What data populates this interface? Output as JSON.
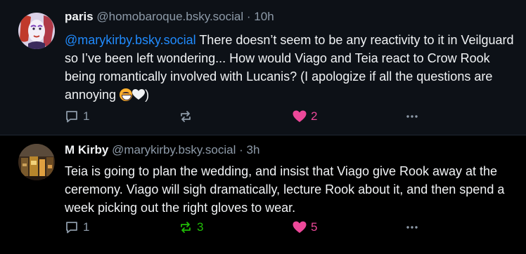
{
  "posts": [
    {
      "author": "paris",
      "handle": "@homobaroque.bsky.social",
      "separator": "·",
      "time": "10h",
      "mention": "@marykirby.bsky.social",
      "text": " There doesn’t seem to be any reactivity to it in Veilguard so I’ve been left wondering... How would Viago and Teia react to Crow Rook being romantically involved with Lucanis? (I apologize if all the questions are annoying ",
      "text_end": ")",
      "reply_count": "1",
      "repost_count": "",
      "like_count": "2",
      "liked": true,
      "reposted": false
    },
    {
      "author": "M Kirby",
      "handle": "@marykirby.bsky.social",
      "separator": "·",
      "time": "3h",
      "text": "Teia is going to plan the wedding, and insist that Viago give Rook away at the ceremony. Viago will sigh dramatically, lecture Rook about it, and then spend a week picking out the right gloves to wear.",
      "reply_count": "1",
      "repost_count": "3",
      "like_count": "5",
      "liked": true,
      "reposted": true
    }
  ],
  "icons": {
    "reply": "speech-bubble-icon",
    "repost": "repost-arrows-icon",
    "like": "heart-icon",
    "more": "ellipsis-icon"
  },
  "colors": {
    "accent": "#208bfe",
    "like": "#ec4899",
    "repost": "#20bc07",
    "muted": "#8d9aa8"
  }
}
